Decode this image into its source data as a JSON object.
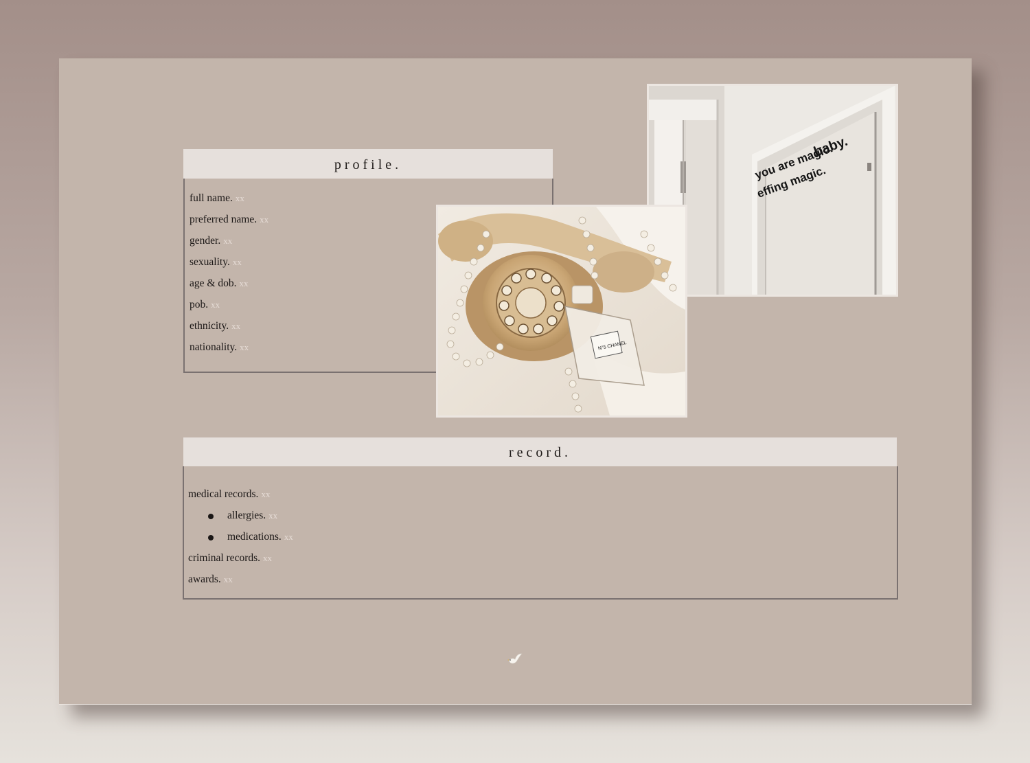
{
  "profile": {
    "title": "profile.",
    "fields": [
      {
        "label": "full name.",
        "value": "xx"
      },
      {
        "label": "preferred name.",
        "value": "xx"
      },
      {
        "label": "gender.",
        "value": "xx"
      },
      {
        "label": "sexuality.",
        "value": "xx"
      },
      {
        "label": "age & dob.",
        "value": "xx"
      },
      {
        "label": "pob.",
        "value": "xx"
      },
      {
        "label": "ethnicity.",
        "value": "xx"
      },
      {
        "label": "nationality.",
        "value": "xx"
      }
    ]
  },
  "record": {
    "title": "record.",
    "medical": {
      "label": "medical records.",
      "value": "xx"
    },
    "allergies": {
      "label": "allergies.",
      "value": "xx"
    },
    "medications": {
      "label": "medications.",
      "value": "xx"
    },
    "criminal": {
      "label": "criminal records.",
      "value": "xx"
    },
    "awards": {
      "label": "awards.",
      "value": "xx"
    }
  },
  "mirror_photo": {
    "line1": "you are magic.",
    "line1b": "baby.",
    "line2": "effing magic."
  },
  "perfume_photo": {
    "bottle_label": "N°5 CHANEL"
  },
  "colors": {
    "card": "#c3b5ab",
    "header": "#e6e0dc",
    "value_text": "#e6dcd6",
    "border": "#7a7170"
  },
  "icons": {
    "footer": "dove-icon"
  }
}
